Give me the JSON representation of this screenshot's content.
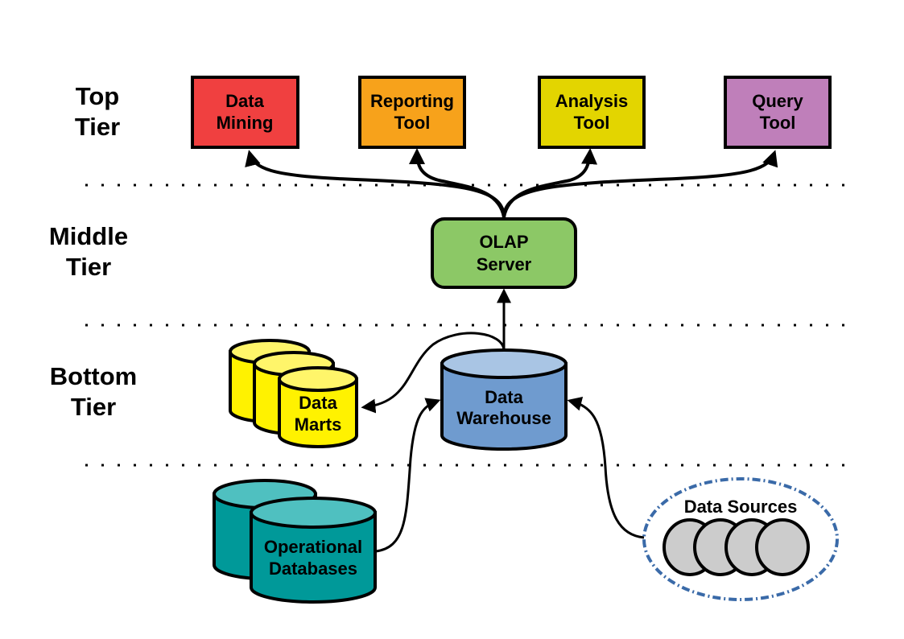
{
  "tiers": [
    {
      "line1": "Top",
      "line2": "Tier"
    },
    {
      "line1": "Middle",
      "line2": "Tier"
    },
    {
      "line1": "Bottom",
      "line2": "Tier"
    }
  ],
  "tools": [
    {
      "line1": "Data",
      "line2": "Mining",
      "color": "#f04040"
    },
    {
      "line1": "Reporting",
      "line2": "Tool",
      "color": "#f7a21b"
    },
    {
      "line1": "Analysis",
      "line2": "Tool",
      "color": "#e3d500"
    },
    {
      "line1": "Query",
      "line2": "Tool",
      "color": "#bf7fba"
    }
  ],
  "olap": {
    "line1": "OLAP",
    "line2": "Server",
    "color": "#8cc866"
  },
  "warehouse": {
    "line1": "Data",
    "line2": "Warehouse",
    "color": "#6f9bcf",
    "top_color": "#a9c5e4"
  },
  "marts": {
    "line1": "Data",
    "line2": "Marts",
    "color": "#fff200",
    "top_color": "#fff56a"
  },
  "operational": {
    "line1": "Operational",
    "line2": "Databases",
    "color": "#009999",
    "top_color": "#4fc0c0"
  },
  "sources": {
    "label": "Data Sources",
    "color": "#cccccc",
    "border_color": "#3a6aa8"
  }
}
